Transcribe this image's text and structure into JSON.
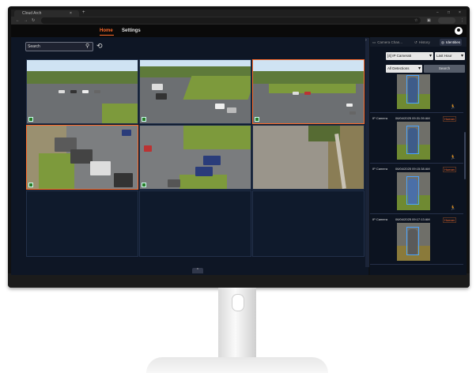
{
  "browser": {
    "tab_title": "Cloud Arch",
    "tab_close": "×",
    "new_tab": "+",
    "back": "←",
    "forward": "→",
    "reload": "↻",
    "star": "☆",
    "tabs_icon": "▣",
    "menu": "⋮",
    "minimize": "−",
    "maximize": "□",
    "close": "×"
  },
  "nav": {
    "home": "Home",
    "settings": "Settings"
  },
  "toolbar": {
    "search_placeholder": "Search",
    "search_icon": "⚲",
    "refresh_icon": "⟲"
  },
  "grid": {
    "collapse_icon": "›",
    "toggle_icon": "⌃"
  },
  "panel": {
    "tabs": [
      {
        "icon": "▭",
        "label": "Camera Chan..."
      },
      {
        "icon": "↺",
        "label": "History"
      },
      {
        "icon": "◎",
        "label": "Identities"
      }
    ],
    "camera_select": "[4] IP Camera5",
    "time_select": "Last Hour",
    "detection_select": "All Detections",
    "search_button": "Search",
    "chevron": "▾",
    "results": [
      {
        "camera": "",
        "time": "",
        "tag": "",
        "icon": "🏃"
      },
      {
        "camera": "IP Camera",
        "time": "06/04/2025 09:31:39 AM",
        "tag": "Human",
        "icon": "🏃"
      },
      {
        "camera": "IP Camera",
        "time": "06/04/2025 09:15:38 AM",
        "tag": "Human",
        "icon": "🏃"
      },
      {
        "camera": "IP Camera",
        "time": "06/04/2025 09:17:13 AM",
        "tag": "Human",
        "icon": ""
      }
    ]
  },
  "colors": {
    "accent": "#ff6a2a",
    "panel_bg": "#0c1320",
    "grid_bg": "#0e1625"
  }
}
